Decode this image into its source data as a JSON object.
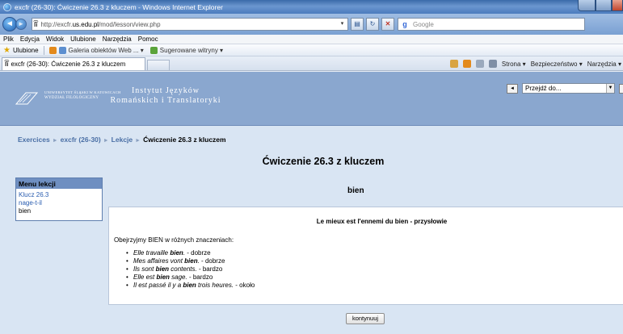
{
  "window": {
    "title": "excfr (26-30): Ćwiczenie 26.3 z kluczem - Windows Internet Explorer"
  },
  "address": {
    "url_prefix": "http://excfr.",
    "url_domain": "us.edu.pl",
    "url_suffix": "/mod/lesson/view.php",
    "search_placeholder": "Google"
  },
  "menubar": {
    "items": [
      "Plik",
      "Edycja",
      "Widok",
      "Ulubione",
      "Narzędzia",
      "Pomoc"
    ]
  },
  "favorites": {
    "label": "Ulubione",
    "items": [
      "Galeria obiektów Web ... ▾",
      "Sugerowane witryny ▾"
    ]
  },
  "tab": {
    "label": "excfr (26-30): Ćwiczenie 26.3 z kluczem"
  },
  "commandbar": {
    "page_label": "Strona ▾",
    "safety_label": "Bezpieczeństwo ▾",
    "tools_label": "Narzędzia ▾"
  },
  "header": {
    "uni_line1": "UNIWERSYTET ŚLĄSKI W KATOWICACH",
    "uni_line2": "WYDZIAŁ FILOLOGICZNY",
    "institute_line1": "Instytut Języków",
    "institute_line2": "Romańskich i Translatoryki",
    "jump_label": "Przejdź do...",
    "prev_btn": "◄",
    "next_btn": "►"
  },
  "breadcrumb": {
    "items": [
      "Exercices",
      "excfr (26-30)",
      "Lekcje"
    ],
    "current": "Ćwiczenie 26.3 z kluczem",
    "separator": "►"
  },
  "lesson": {
    "title": "Ćwiczenie 26.3 z kluczem",
    "page_name": "bien"
  },
  "lesson_menu": {
    "heading": "Menu lekcji",
    "items": [
      "Klucz 26.3",
      "nage-t-il",
      "bien"
    ]
  },
  "content": {
    "title": "Le mieux est l'ennemi du bien - przysłowie",
    "intro": "Obejrzyjmy BIEN w różnych znaczeniach:",
    "examples": [
      {
        "before": "Elle travaille ",
        "bold": "bien",
        "after": ".",
        "translation": " - dobrze"
      },
      {
        "before": "Mes affaires vont ",
        "bold": "bien",
        "after": ".",
        "translation": " - dobrze"
      },
      {
        "before": "Ils sont ",
        "bold": "bien",
        "after": " contents.",
        "translation": " - bardzo"
      },
      {
        "before": "Elle est ",
        "bold": "bien",
        "after": " sage.",
        "translation": " - bardzo"
      },
      {
        "before": "Il est passé il y a ",
        "bold": "bien",
        "after": " trois heures.",
        "translation": " - około"
      }
    ]
  },
  "continue_button": "kontynuuj"
}
